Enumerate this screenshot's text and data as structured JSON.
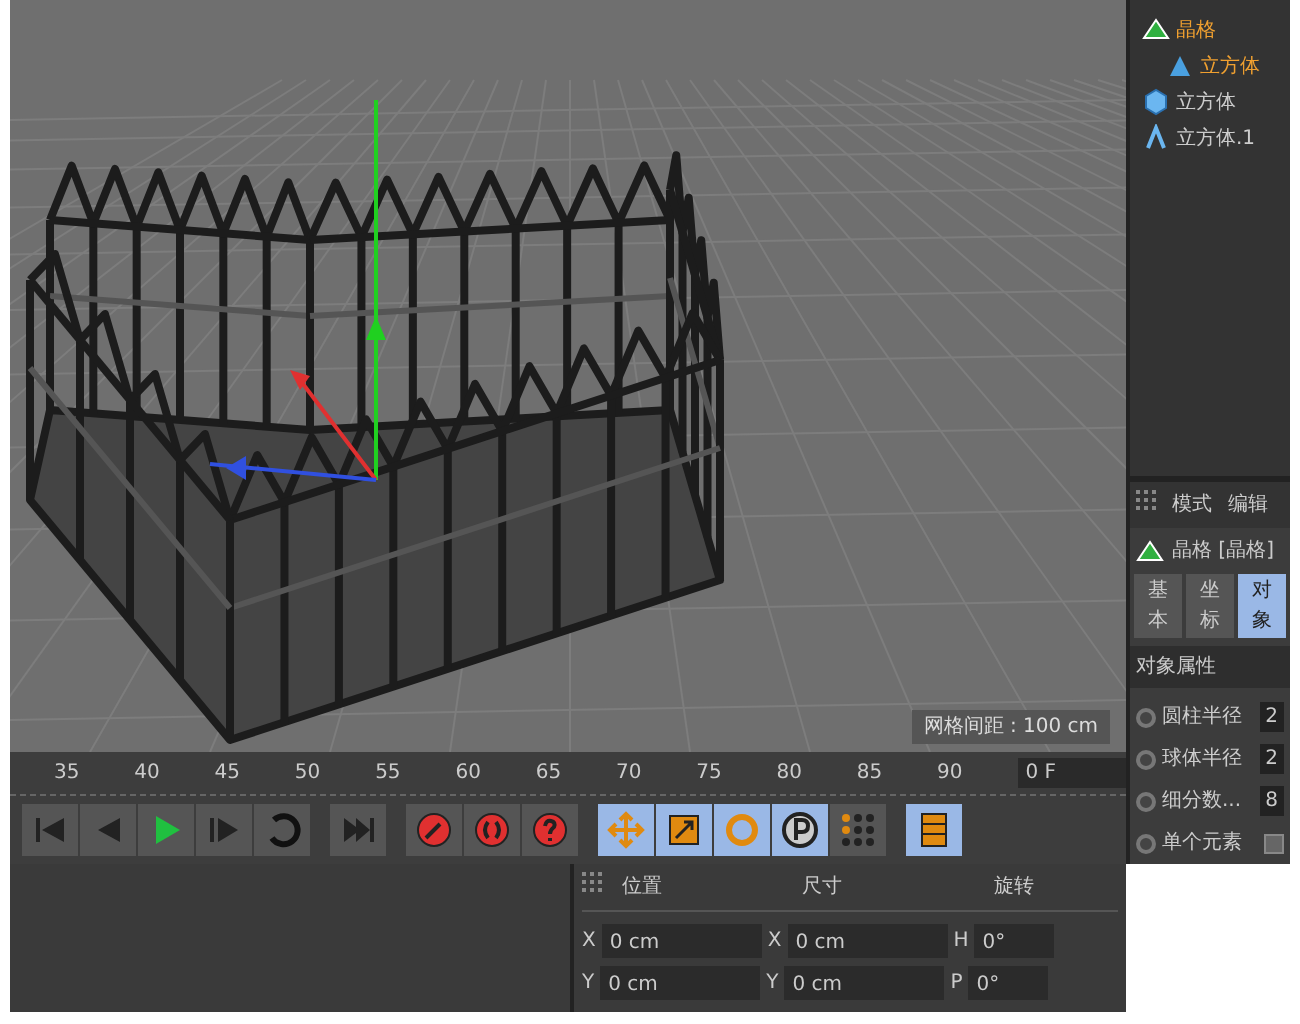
{
  "viewport": {
    "grid_spacing": "网格间距 : 100 cm"
  },
  "object_tree": [
    {
      "label": "晶格",
      "kind": "lattice",
      "selected": true,
      "children": [
        {
          "label": "立方体",
          "kind": "cone",
          "selected": true
        }
      ]
    },
    {
      "label": "立方体",
      "kind": "cube",
      "selected": false
    },
    {
      "label": "立方体.1",
      "kind": "bend",
      "selected": false
    }
  ],
  "attributes": {
    "menu": [
      "模式",
      "编辑"
    ],
    "object_name": "晶格 [晶格]",
    "tabs": [
      {
        "label": "基本",
        "selected": false
      },
      {
        "label": "坐标",
        "selected": false
      },
      {
        "label": "对象",
        "selected": true
      }
    ],
    "section": "对象属性",
    "params": [
      {
        "kind": "number",
        "label": "圆柱半径",
        "value": "2"
      },
      {
        "kind": "number",
        "label": "球体半径",
        "value": "2"
      },
      {
        "kind": "number",
        "label": "细分数...",
        "value": "8"
      },
      {
        "kind": "checkbox",
        "label": "单个元素",
        "checked": false
      }
    ]
  },
  "timeline": {
    "ticks": [
      "35",
      "40",
      "45",
      "50",
      "55",
      "60",
      "65",
      "70",
      "75",
      "80",
      "85",
      "90"
    ],
    "frame": "0 F"
  },
  "coordinates": {
    "headers": [
      "位置",
      "尺寸",
      "旋转"
    ],
    "rows": [
      {
        "axis": "X",
        "position": "0 cm",
        "size_axis": "X",
        "size": "0 cm",
        "rot_axis": "H",
        "rotation": "0°"
      },
      {
        "axis": "Y",
        "position": "0 cm",
        "size_axis": "Y",
        "size": "0 cm",
        "rot_axis": "P",
        "rotation": "0°"
      }
    ]
  }
}
